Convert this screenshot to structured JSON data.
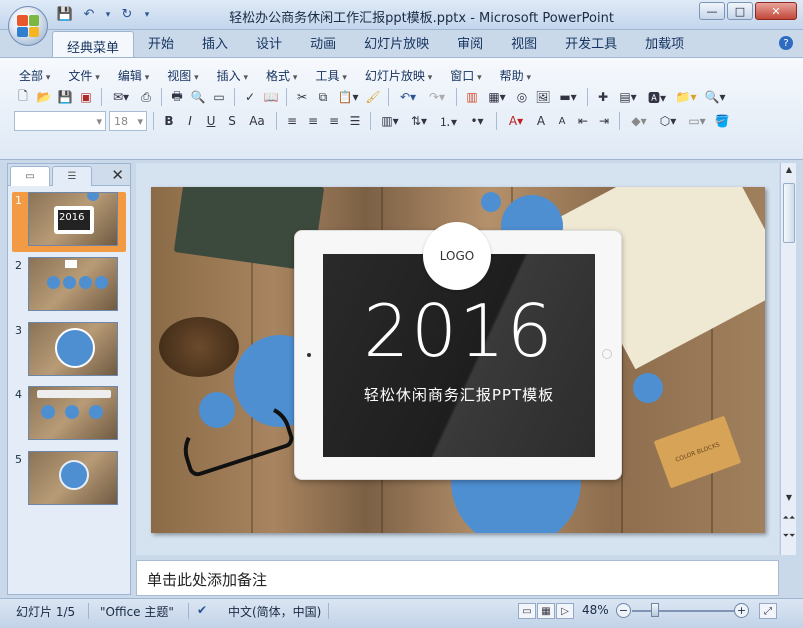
{
  "window": {
    "title": "轻松办公商务休闲工作汇报ppt模板.pptx - Microsoft PowerPoint",
    "minimize": "—",
    "maximize": "□",
    "close": "✕"
  },
  "tabs": [
    "经典菜单",
    "开始",
    "插入",
    "设计",
    "动画",
    "幻灯片放映",
    "审阅",
    "视图",
    "开发工具",
    "加载项"
  ],
  "menubar": [
    "全部",
    "文件",
    "编辑",
    "视图",
    "插入",
    "格式",
    "工具",
    "幻灯片放映",
    "窗口",
    "帮助"
  ],
  "font": {
    "name": "",
    "size": "18"
  },
  "format_buttons": [
    "B",
    "I",
    "U",
    "S",
    "Aa"
  ],
  "thumbnails": [
    {
      "num": "1",
      "selected": true
    },
    {
      "num": "2",
      "selected": false
    },
    {
      "num": "3",
      "selected": false
    },
    {
      "num": "4",
      "selected": false
    },
    {
      "num": "5",
      "selected": false
    }
  ],
  "slide": {
    "logo": "LOGO",
    "year": "2016",
    "subtitle": "轻松休闲商务汇报PPT模板",
    "box_label": "COLOR BLOCKS"
  },
  "notes": {
    "placeholder": "单击此处添加备注"
  },
  "status": {
    "slide_counter": "幻灯片 1/5",
    "theme": "\"Office 主题\"",
    "language": "中文(简体，中国)",
    "zoom": "48%"
  },
  "colors": {
    "accent_blue": "#4e8fd2",
    "selected_thumb": "#f39a45",
    "ribbon_border": "#9fb6d3"
  }
}
